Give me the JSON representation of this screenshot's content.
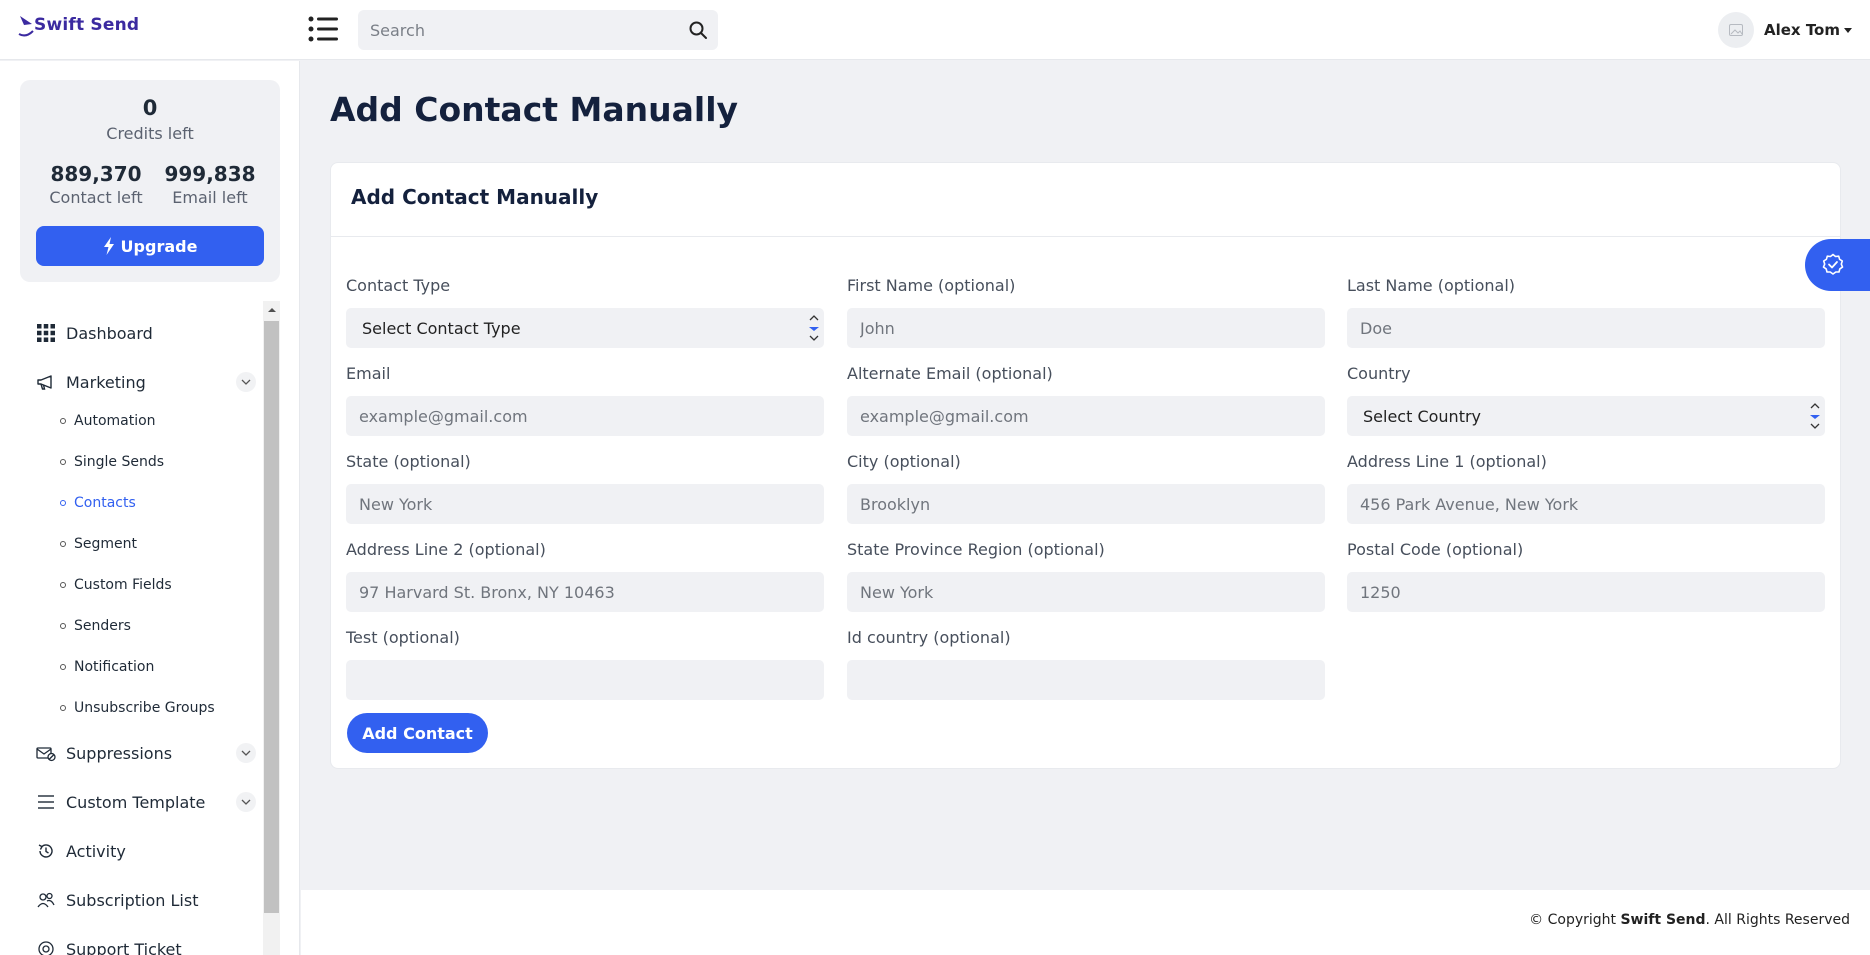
{
  "brand": {
    "name": "Swift Send"
  },
  "search": {
    "placeholder": "Search"
  },
  "user": {
    "name": "Alex Tom"
  },
  "credits": {
    "credits_value": "0",
    "credits_label": "Credits left",
    "contact_value": "889,370",
    "contact_label": "Contact left",
    "email_value": "999,838",
    "email_label": "Email left",
    "upgrade_label": "Upgrade"
  },
  "nav": {
    "dashboard": "Dashboard",
    "marketing": "Marketing",
    "marketing_items": [
      "Automation",
      "Single Sends",
      "Contacts",
      "Segment",
      "Custom Fields",
      "Senders",
      "Notification",
      "Unsubscribe Groups"
    ],
    "active_item": "Contacts",
    "suppressions": "Suppressions",
    "custom_template": "Custom Template",
    "activity": "Activity",
    "subscription_list": "Subscription List",
    "support_ticket": "Support Ticket"
  },
  "page": {
    "title": "Add Contact Manually"
  },
  "form": {
    "card_title": "Add Contact Manually",
    "contact_type": {
      "label": "Contact Type",
      "value": "Select Contact Type"
    },
    "first_name": {
      "label": "First Name (optional)",
      "placeholder": "John"
    },
    "last_name": {
      "label": "Last Name (optional)",
      "placeholder": "Doe"
    },
    "email": {
      "label": "Email",
      "placeholder": "example@gmail.com"
    },
    "alt_email": {
      "label": "Alternate Email (optional)",
      "placeholder": "example@gmail.com"
    },
    "country": {
      "label": "Country",
      "value": "Select Country"
    },
    "state": {
      "label": "State (optional)",
      "placeholder": "New York"
    },
    "city": {
      "label": "City (optional)",
      "placeholder": "Brooklyn"
    },
    "address1": {
      "label": "Address Line 1 (optional)",
      "placeholder": "456 Park Avenue, New York"
    },
    "address2": {
      "label": "Address Line 2 (optional)",
      "placeholder": "97 Harvard St. Bronx, NY 10463"
    },
    "state_region": {
      "label": "State Province Region (optional)",
      "placeholder": "New York"
    },
    "postal": {
      "label": "Postal Code (optional)",
      "placeholder": "1250"
    },
    "test": {
      "label": "Test (optional)",
      "placeholder": ""
    },
    "id_country": {
      "label": "Id country (optional)",
      "placeholder": ""
    },
    "submit_label": "Add Contact"
  },
  "footer": {
    "prefix": "© Copyright",
    "brand": "Swift Send",
    "suffix": ". All Rights Reserved"
  },
  "colors": {
    "accent": "#3260f0",
    "brand": "#3b2aa0",
    "background": "#f0f1f4"
  }
}
